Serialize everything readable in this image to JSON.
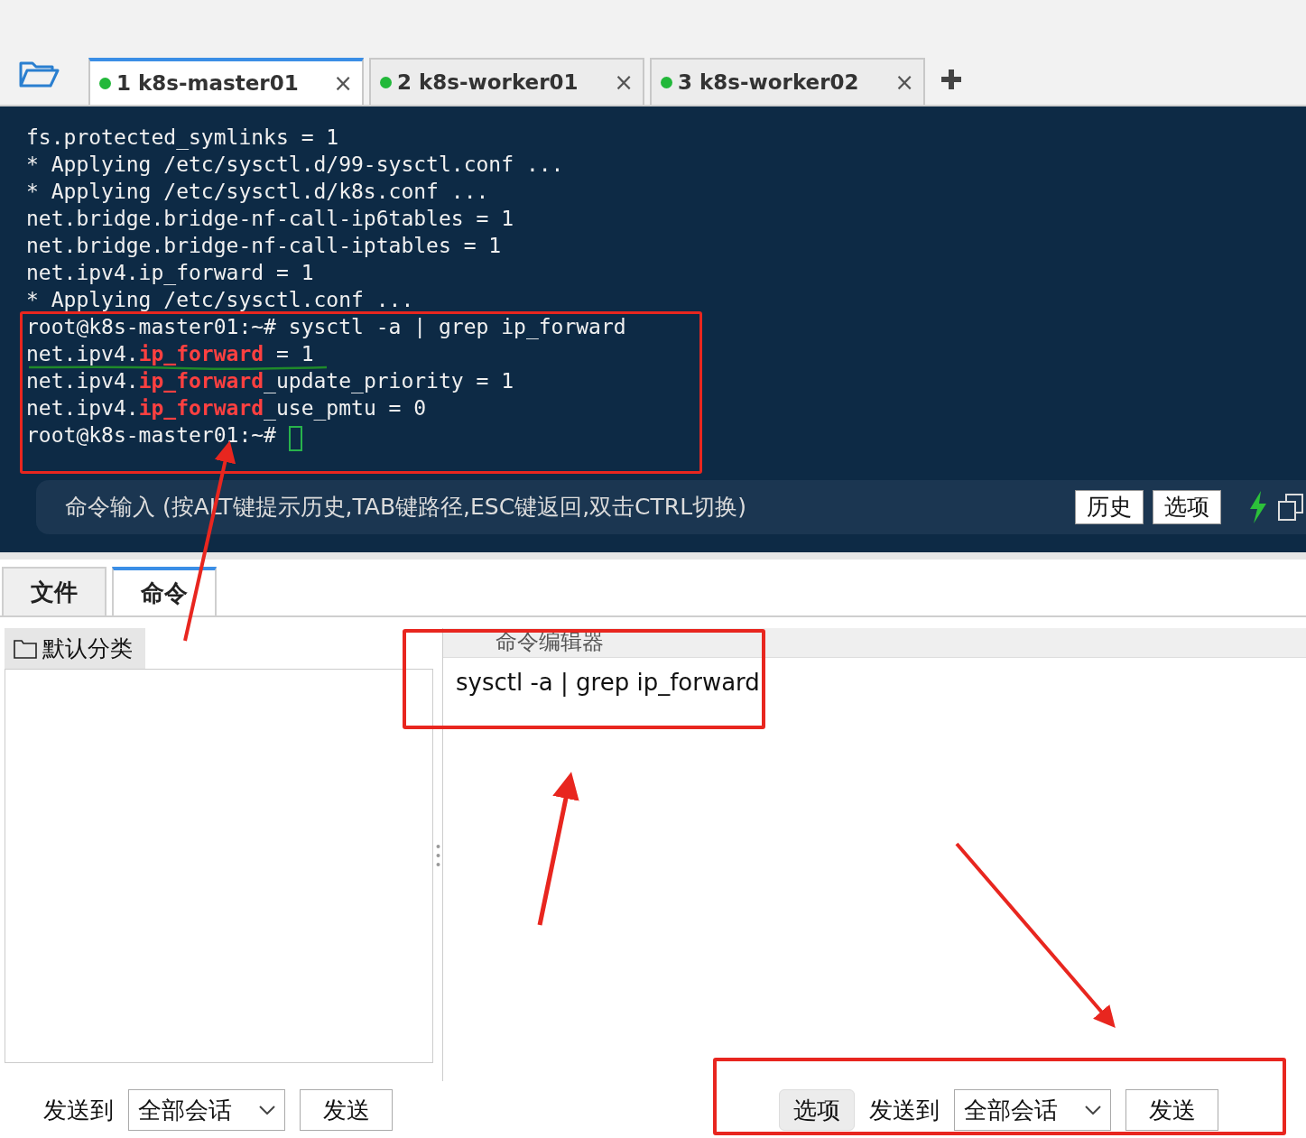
{
  "tabs": [
    {
      "label": "1 k8s-master01",
      "selected": true,
      "connected": true,
      "close": "×"
    },
    {
      "label": "2 k8s-worker01",
      "selected": false,
      "connected": true,
      "close": "×"
    },
    {
      "label": "3 k8s-worker02",
      "selected": false,
      "connected": true,
      "close": "×"
    }
  ],
  "terminal": {
    "lines": [
      {
        "segments": [
          {
            "text": "fs.protected_symlinks = 1",
            "matched": false
          }
        ]
      },
      {
        "segments": [
          {
            "text": "* Applying /etc/sysctl.d/99-sysctl.conf ...",
            "matched": false
          }
        ]
      },
      {
        "segments": [
          {
            "text": "* Applying /etc/sysctl.d/k8s.conf ...",
            "matched": false
          }
        ]
      },
      {
        "segments": [
          {
            "text": "net.bridge.bridge-nf-call-ip6tables = 1",
            "matched": false
          }
        ]
      },
      {
        "segments": [
          {
            "text": "net.bridge.bridge-nf-call-iptables = 1",
            "matched": false
          }
        ]
      },
      {
        "segments": [
          {
            "text": "net.ipv4.ip_forward = 1",
            "matched": false
          }
        ]
      },
      {
        "segments": [
          {
            "text": "* Applying /etc/sysctl.conf ...",
            "matched": false
          }
        ]
      },
      {
        "segments": [
          {
            "text": "root@k8s-master01:~# sysctl -a | grep ip_forward",
            "matched": false
          }
        ]
      },
      {
        "segments": [
          {
            "text": "net.ipv4.",
            "matched": false
          },
          {
            "text": "ip_forward",
            "matched": true
          },
          {
            "text": " = 1",
            "matched": false
          }
        ]
      },
      {
        "segments": [
          {
            "text": "net.ipv4.",
            "matched": false
          },
          {
            "text": "ip_forward",
            "matched": true
          },
          {
            "text": "_update_priority = 1",
            "matched": false
          }
        ]
      },
      {
        "segments": [
          {
            "text": "net.ipv4.",
            "matched": false
          },
          {
            "text": "ip_forward",
            "matched": true
          },
          {
            "text": "_use_pmtu = 0",
            "matched": false
          }
        ]
      },
      {
        "segments": [
          {
            "text": "root@k8s-master01:~# ",
            "matched": false
          }
        ],
        "cursor": true
      }
    ]
  },
  "command_input": {
    "placeholder": "命令输入 (按ALT键提示历史,TAB键路径,ESC键返回,双击CTRL切换)",
    "buttons": [
      "历史",
      "选项"
    ]
  },
  "panel_tabs": [
    {
      "label": "文件",
      "selected": false
    },
    {
      "label": "命令",
      "selected": true
    }
  ],
  "category": "默认分类",
  "editor": {
    "title": "命令编辑器",
    "value": "sysctl -a | grep ip_forward"
  },
  "left_footer": {
    "send_to_label": "发送到",
    "target": "全部会话",
    "send": "发送"
  },
  "right_footer": {
    "options": "选项",
    "send_to_label": "发送到",
    "target": "全部会话",
    "send": "发送"
  }
}
